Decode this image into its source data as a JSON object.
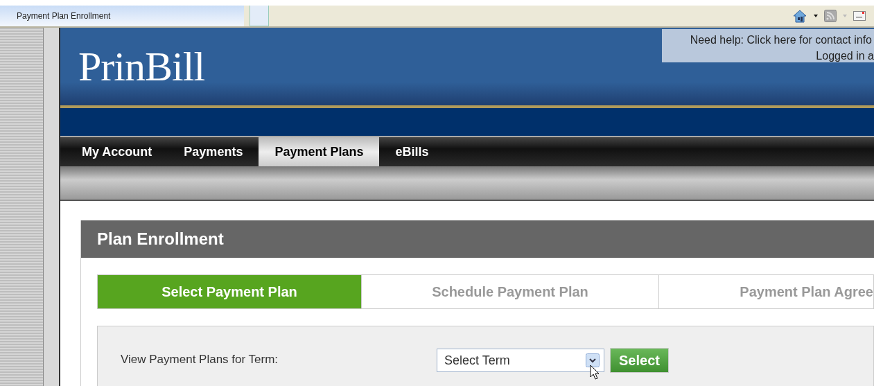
{
  "browser": {
    "tab_title": "Payment Plan Enrollment"
  },
  "header": {
    "logo": "PrinBill",
    "help_link": "Need help: Click here for contact info",
    "login_status": "Logged in a"
  },
  "nav": [
    {
      "label": "My Account",
      "selected": false
    },
    {
      "label": "Payments",
      "selected": false
    },
    {
      "label": "Payment Plans",
      "selected": true
    },
    {
      "label": "eBills",
      "selected": false
    }
  ],
  "panel": {
    "title": "Plan Enrollment",
    "steps": [
      {
        "label": "Select Payment Plan",
        "selected": true
      },
      {
        "label": "Schedule Payment Plan",
        "selected": false
      },
      {
        "label": "Payment Plan Agree",
        "selected": false
      }
    ],
    "term_label": "View Payment Plans for Term:",
    "term_select": "Select Term",
    "select_button": "Select"
  }
}
